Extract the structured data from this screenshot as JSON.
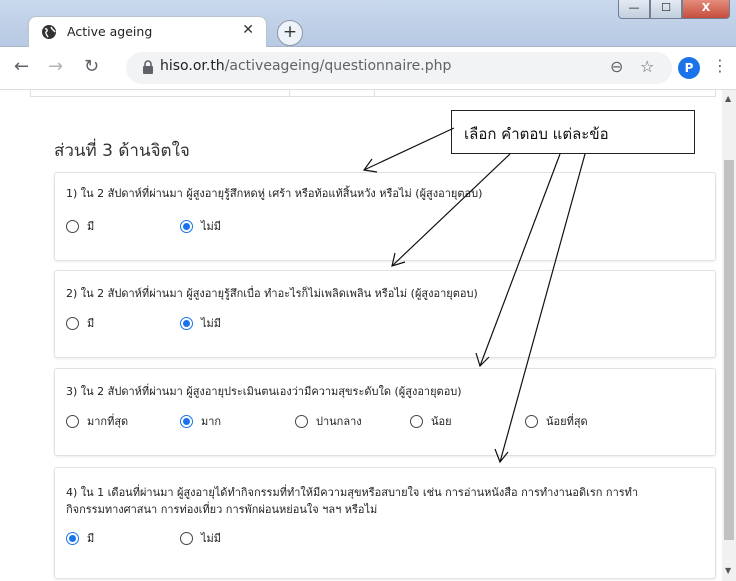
{
  "browser": {
    "tab_title": "Active ageing",
    "url_host": "hiso.or.th",
    "url_path": "/activeageing/questionnaire.php",
    "profile_initial": "P",
    "window_buttons": [
      "—",
      "☐",
      "X"
    ]
  },
  "page": {
    "section_title": "ส่วนที่ 3 ด้านจิตใจ",
    "questions": [
      {
        "text": "1) ใน 2 สัปดาห์ที่ผ่านมา ผู้สูงอายุรู้สึกหดหู่ เศร้า หรือท้อแท้สิ้นหวัง หรือไม่ (ผู้สูงอายุตอบ)",
        "options": [
          "มี",
          "ไม่มี"
        ],
        "selected": "ไม่มี"
      },
      {
        "text": "2) ใน 2 สัปดาห์ที่ผ่านมา ผู้สูงอายุรู้สึกเบื่อ ทำอะไรก็ไม่เพลิดเพลิน หรือไม่ (ผู้สูงอายุตอบ)",
        "options": [
          "มี",
          "ไม่มี"
        ],
        "selected": "ไม่มี"
      },
      {
        "text": "3) ใน 2 สัปดาห์ที่ผ่านมา ผู้สูงอายุประเมินตนเองว่ามีความสุขระดับใด (ผู้สูงอายุตอบ)",
        "options": [
          "มากที่สุด",
          "มาก",
          "ปานกลาง",
          "น้อย",
          "น้อยที่สุด"
        ],
        "selected": "มาก"
      },
      {
        "text_line1": "4) ใน 1 เดือนที่ผ่านมา ผู้สูงอายุได้ทำกิจกรรมที่ทำให้มีความสุขหรือสบายใจ เช่น การอ่านหนังสือ การทำงานอดิเรก การทำ",
        "text_line2": "กิจกรรมทางศาสนา การท่องเที่ยว การพักผ่อนหย่อนใจ ฯลฯ หรือไม่",
        "options": [
          "มี",
          "ไม่มี"
        ],
        "selected": "มี"
      }
    ]
  },
  "annotation": {
    "callout_text": "เลือก คำตอบ แต่ละข้อ"
  },
  "colors": {
    "accent": "#1a73e8",
    "titlebar": "#c9d8ec"
  }
}
